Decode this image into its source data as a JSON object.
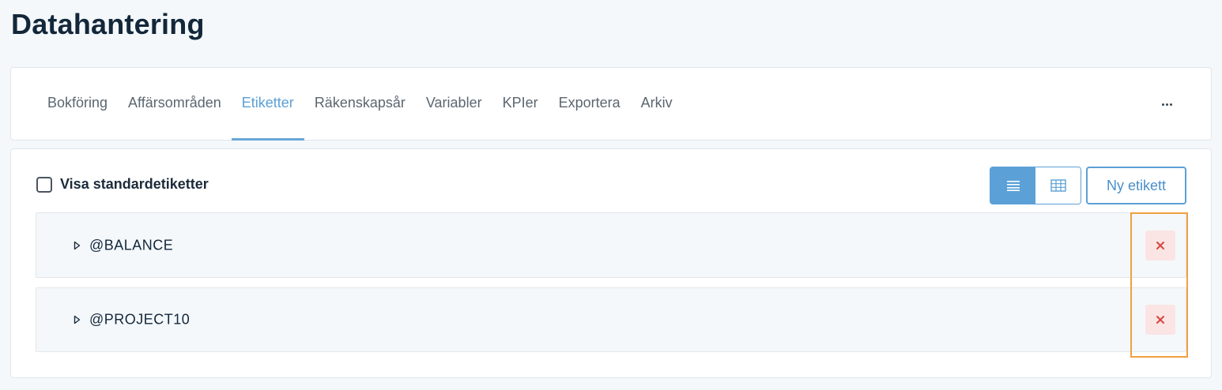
{
  "page": {
    "title": "Datahantering"
  },
  "tabs": [
    {
      "label": "Bokföring",
      "active": false
    },
    {
      "label": "Affärsområden",
      "active": false
    },
    {
      "label": "Etiketter",
      "active": true
    },
    {
      "label": "Räkenskapsår",
      "active": false
    },
    {
      "label": "Variabler",
      "active": false
    },
    {
      "label": "KPIer",
      "active": false
    },
    {
      "label": "Exportera",
      "active": false
    },
    {
      "label": "Arkiv",
      "active": false
    }
  ],
  "more_menu": {
    "icon": "ellipsis-icon"
  },
  "toolbar": {
    "show_standard_label": "Visa standardetiketter",
    "show_standard_checked": false,
    "view_list_icon": "list-icon",
    "view_grid_icon": "grid-icon",
    "new_label": "Ny etikett"
  },
  "tag_list": [
    {
      "name": "@BALANCE",
      "expand_icon": "caret-right-icon",
      "delete_icon": "close-icon"
    },
    {
      "name": "@PROJECT10",
      "expand_icon": "caret-right-icon",
      "delete_icon": "close-icon"
    }
  ],
  "colors": {
    "accent": "#5ba0d6",
    "delete_bg": "#fbe4e4",
    "delete_icon": "#d9473f",
    "highlight": "#f0a040"
  }
}
